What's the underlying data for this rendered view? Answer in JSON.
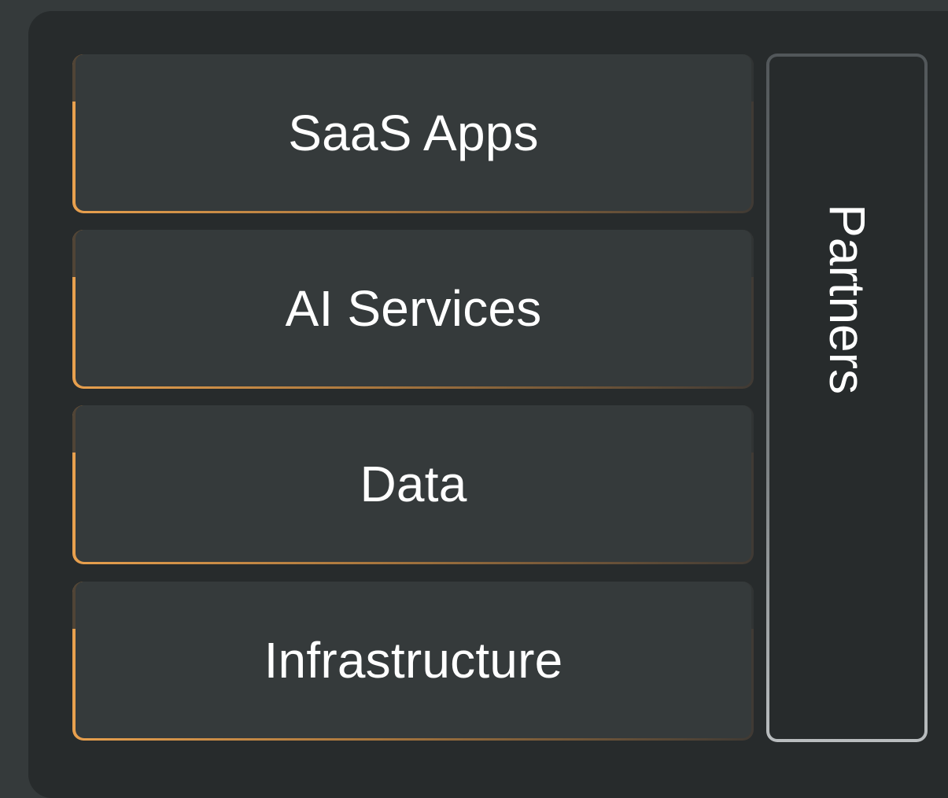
{
  "layers": [
    {
      "label": "SaaS Apps"
    },
    {
      "label": "AI Services"
    },
    {
      "label": "Data"
    },
    {
      "label": "Infrastructure"
    }
  ],
  "side": {
    "label": "Partners"
  },
  "colors": {
    "background": "#353a3b",
    "panel": "#272b2c",
    "layer_fill": "#353a3b",
    "layer_accent": "#e8a04e",
    "side_border": "#b9bdbf",
    "text": "#ffffff"
  }
}
